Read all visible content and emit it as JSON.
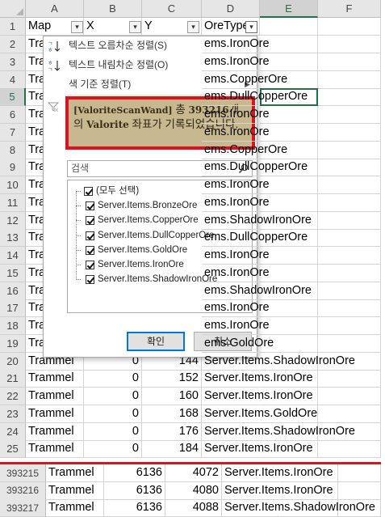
{
  "columns": [
    {
      "letter": "A",
      "header": "Map"
    },
    {
      "letter": "B",
      "header": "X"
    },
    {
      "letter": "C",
      "header": "Y"
    },
    {
      "letter": "D",
      "header": "OreType"
    },
    {
      "letter": "E",
      "header": ""
    },
    {
      "letter": "F",
      "header": ""
    }
  ],
  "row1_num": "1",
  "rows": [
    {
      "num": "2",
      "a": "Tra",
      "d": "ems.IronOre"
    },
    {
      "num": "3",
      "a": "Tra",
      "d": "ems.IronOre"
    },
    {
      "num": "4",
      "a": "Tra",
      "d": "ems.CopperOre"
    },
    {
      "num": "5",
      "a": "Tra",
      "d": "ems.DullCopperOre"
    },
    {
      "num": "6",
      "a": "Tra",
      "d": "ems.IronOre"
    },
    {
      "num": "7",
      "a": "Tra",
      "d": "ems.IronOre"
    },
    {
      "num": "8",
      "a": "Tra",
      "d": "ems.CopperOre"
    },
    {
      "num": "9",
      "a": "Tra",
      "d": "ems.DullCopperOre"
    },
    {
      "num": "10",
      "a": "Tra",
      "d": "ems.IronOre"
    },
    {
      "num": "11",
      "a": "Tra",
      "d": "ems.IronOre"
    },
    {
      "num": "12",
      "a": "Tra",
      "d": "ems.ShadowIronOre"
    },
    {
      "num": "13",
      "a": "Tra",
      "d": "ems.DullCopperOre"
    },
    {
      "num": "14",
      "a": "Tra",
      "d": "ems.IronOre"
    },
    {
      "num": "15",
      "a": "Tra",
      "d": "ems.IronOre"
    },
    {
      "num": "16",
      "a": "Tra",
      "d": "ems.ShadowIronOre"
    },
    {
      "num": "17",
      "a": "Tra",
      "d": "ems.IronOre"
    },
    {
      "num": "18",
      "a": "Tra",
      "d": "ems.IronOre"
    },
    {
      "num": "19",
      "a": "Tra",
      "d": "ems.GoldOre"
    },
    {
      "num": "20",
      "a": "Trammel",
      "b": "0",
      "c": "144",
      "d": "Server.Items.ShadowIronOre"
    },
    {
      "num": "21",
      "a": "Trammel",
      "b": "0",
      "c": "152",
      "d": "Server.Items.IronOre"
    },
    {
      "num": "22",
      "a": "Trammel",
      "b": "0",
      "c": "160",
      "d": "Server.Items.IronOre"
    },
    {
      "num": "23",
      "a": "Trammel",
      "b": "0",
      "c": "168",
      "d": "Server.Items.GoldOre"
    },
    {
      "num": "24",
      "a": "Trammel",
      "b": "0",
      "c": "176",
      "d": "Server.Items.ShadowIronOre"
    },
    {
      "num": "25",
      "a": "Trammel",
      "b": "0",
      "c": "184",
      "d": "Server.Items.IronOre"
    }
  ],
  "bottom_rows": [
    {
      "num": "393215",
      "a": "Trammel",
      "b": "6136",
      "c": "4072",
      "d": "Server.Items.IronOre"
    },
    {
      "num": "393216",
      "a": "Trammel",
      "b": "6136",
      "c": "4080",
      "d": "Server.Items.IronOre"
    },
    {
      "num": "393217",
      "a": "Trammel",
      "b": "6136",
      "c": "4088",
      "d": "Server.Items.ShadowIronOre"
    }
  ],
  "filter_menu": {
    "sort_asc": "텍스트 오름차순 정렬(S)",
    "sort_desc": "텍스트 내림차순 정렬(O)",
    "sort_color": "색 기준 정렬(T)",
    "search_placeholder": "검색",
    "items": [
      "(모두 선택)",
      "Server.Items.BronzeOre",
      "Server.Items.CopperOre",
      "Server.Items.DullCopperOre",
      "Server.Items.GoldOre",
      "Server.Items.IronOre",
      "Server.Items.ShadowIronOre"
    ],
    "ok_label": "확인",
    "cancel_label": "취소"
  },
  "banner": {
    "tag": "[ValoriteScanWand]",
    "text1": " 총 ",
    "count": "393216",
    "text2": "개의 ",
    "ore": "Valorite",
    "text3": " 좌표가 기록되었습니다."
  },
  "colors": {
    "accent": "#217346",
    "highlight_border": "#e2101c",
    "banner_bg": "#c8b88f"
  }
}
